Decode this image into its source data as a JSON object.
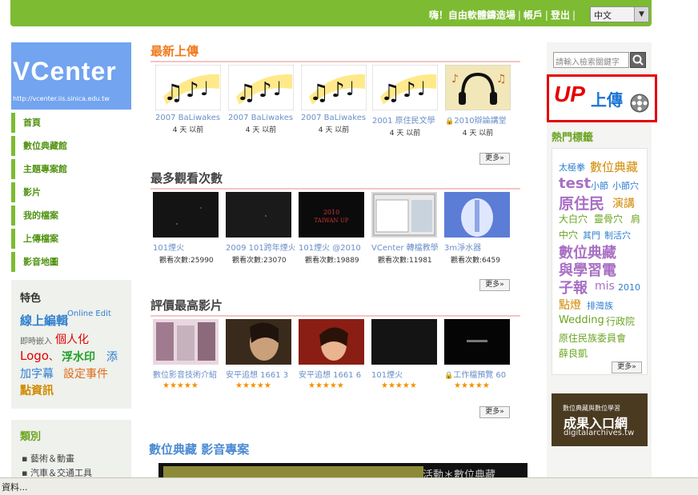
{
  "topbar": {
    "greeting": "嗨！自由軟體鑄造場",
    "account": "帳戶",
    "logout": "登出",
    "lang_selected": "中文"
  },
  "logo": {
    "name": "VCenter",
    "url": "http://vcenter.iis.sinica.edu.tw"
  },
  "nav": {
    "items": [
      "首頁",
      "數位典藏館",
      "主題專案館",
      "影片",
      "我的檔案",
      "上傳檔案",
      "影音地圖"
    ]
  },
  "features": {
    "heading": "特色",
    "online_edit_cn": "線上編輯",
    "online_edit_en": "Online Edit",
    "embed": "即時嵌入",
    "personal": "個人化",
    "logo": "Logo",
    "comma": "、",
    "watermark": "浮水印",
    "add": "添",
    "add_subtitle": "加字幕",
    "set_event": "設定事件",
    "point_info": "點資訊"
  },
  "categories": {
    "heading": "類別",
    "items": [
      "藝術＆動畫",
      "汽車＆交通工具"
    ]
  },
  "sections": {
    "latest": {
      "title": "最新上傳",
      "more": "更多»",
      "items": [
        {
          "caption": "2007 BaLiwakes",
          "time": "4 天 以前",
          "thumb": "music"
        },
        {
          "caption": "2007 BaLiwakes",
          "time": "4 天 以前",
          "thumb": "music"
        },
        {
          "caption": "2007 BaLiwakes",
          "time": "4 天 以前",
          "thumb": "music"
        },
        {
          "caption": "2001 原住民文學",
          "time": "4 天 以前",
          "thumb": "music"
        },
        {
          "caption": "2010辯論講堂",
          "time": "4 天 以前",
          "thumb": "audio"
        }
      ]
    },
    "most_viewed": {
      "title": "最多觀看次數",
      "more": "更多»",
      "items": [
        {
          "caption": "101煙火",
          "views": "觀看次數:25990"
        },
        {
          "caption": "2009 101跨年煙火",
          "views": "觀看次數:23070"
        },
        {
          "caption": "101煙火 @2010",
          "views": "觀看次數:19889"
        },
        {
          "caption": "VCenter 轉檔教學",
          "views": "觀看次數:11981"
        },
        {
          "caption": "3m淨水器",
          "views": "觀看次數:6459"
        }
      ],
      "thumb_text": [
        "2010",
        "TAIWAN UP"
      ]
    },
    "top_rated": {
      "title": "評價最高影片",
      "more": "更多»",
      "items": [
        {
          "caption": "數位影音技術介紹"
        },
        {
          "caption": "安平追想 1661 3"
        },
        {
          "caption": "安平追想 1661 6"
        },
        {
          "caption": "101煙火"
        },
        {
          "caption": "工作檔預覽 60"
        }
      ],
      "stars": "★★★★★"
    }
  },
  "project": {
    "title": "數位典藏 影音專案",
    "overlay": "活動＊數位典藏"
  },
  "right": {
    "search_placeholder": "請輸入檢索關鍵字",
    "upload_up": "UP",
    "upload_text": "上傳",
    "hot_tags_title": "熱門標籤",
    "tags": [
      "太極拳",
      "數位典藏",
      "test",
      "小節",
      "小節穴",
      "原住民",
      "演講",
      "大白穴",
      "靈骨穴",
      "肩",
      "中穴",
      "其門",
      "制活穴",
      "數位典藏",
      "與學習電",
      "子報",
      "mis",
      "2010",
      "點燈",
      "排灣族",
      "Wedding",
      "行政院",
      "原住民族委員會",
      "薛良凱"
    ],
    "tags_more": "更多»",
    "banner_top": "數位典藏與數位學習",
    "banner_mid": "成果入口網",
    "banner_url": "digitalarchives.tw"
  },
  "status": {
    "text": "資料..."
  },
  "colors": {
    "green": "#7dbb32",
    "blue_link": "#6a8fc9",
    "orange_title": "#f07a1b",
    "nav_green": "#4f9310"
  }
}
